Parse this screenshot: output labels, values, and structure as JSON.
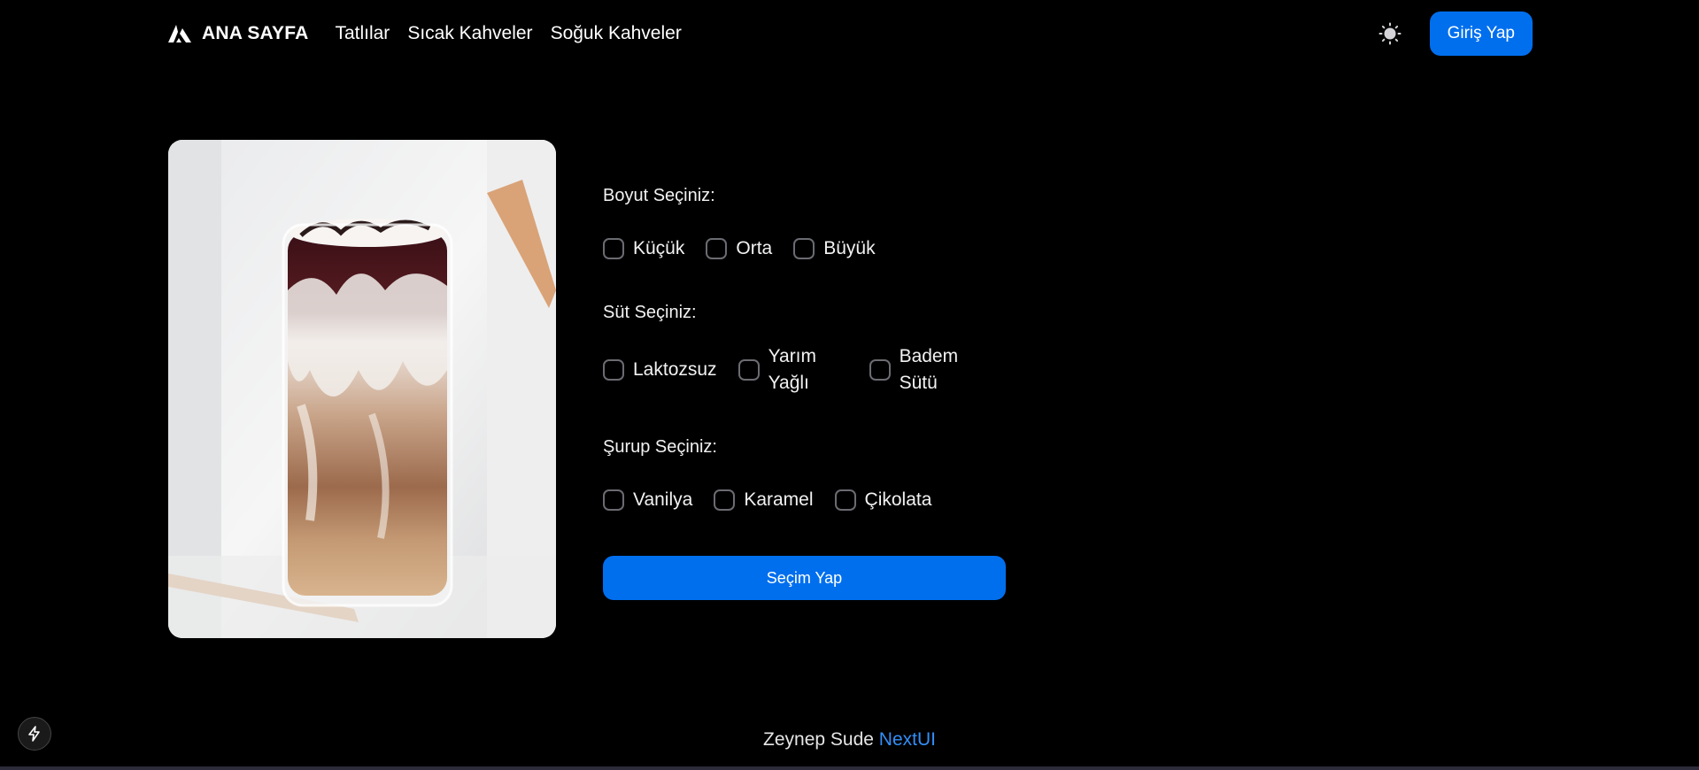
{
  "nav": {
    "brand": "ANA SAYFA",
    "links": [
      "Tatlılar",
      "Sıcak Kahveler",
      "Soğuk Kahveler"
    ],
    "login_label": "Giriş Yap"
  },
  "colors": {
    "accent": "#006fee",
    "link": "#338ef7",
    "background": "#000000"
  },
  "product": {
    "image": "iced-latte-glass-image"
  },
  "form": {
    "size": {
      "title": "Boyut Seçiniz:",
      "options": [
        "Küçük",
        "Orta",
        "Büyük"
      ]
    },
    "milk": {
      "title": "Süt Seçiniz:",
      "options": [
        "Laktozsuz",
        "Yarım Yağlı",
        "Badem Sütü"
      ]
    },
    "syrup": {
      "title": "Şurup Seçiniz:",
      "options": [
        "Vanilya",
        "Karamel",
        "Çikolata"
      ]
    },
    "submit_label": "Seçim Yap"
  },
  "footer": {
    "author": "Zeynep Sude",
    "link": "NextUI"
  }
}
